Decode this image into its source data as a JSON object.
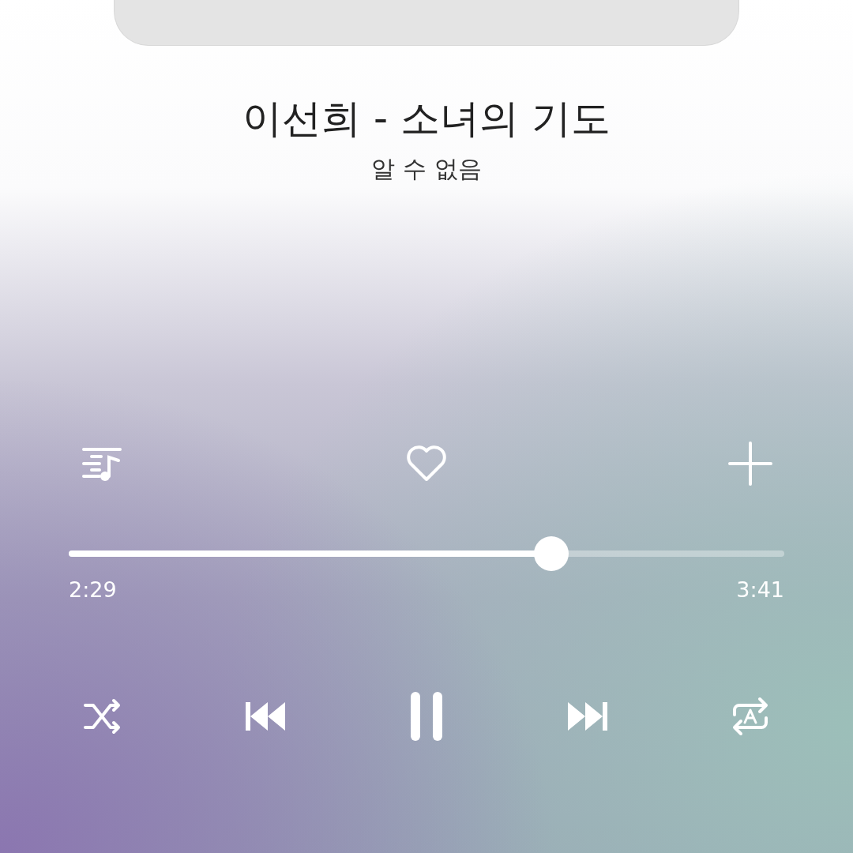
{
  "track": {
    "title": "이선희 - 소녀의 기도",
    "artist": "알 수 없음",
    "liked": false
  },
  "progress": {
    "level": 0.674,
    "elapsed": "2:29",
    "total": "3:41"
  },
  "controls": [
    {
      "kind": "shuffle"
    },
    {
      "kind": "previous"
    },
    {
      "kind": "pause"
    },
    {
      "kind": "next"
    },
    {
      "kind": "repeat"
    }
  ]
}
